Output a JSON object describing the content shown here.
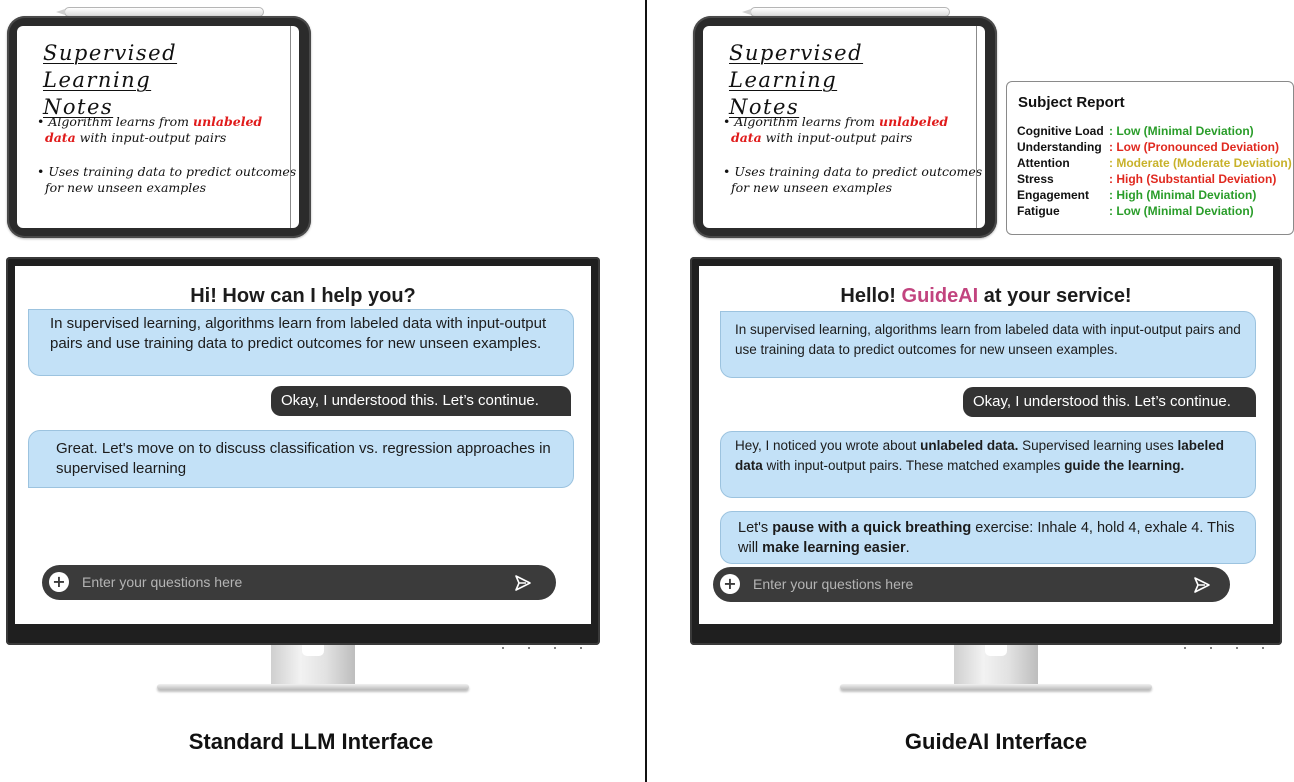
{
  "notes": {
    "title_line1": "Supervised Learning",
    "title_line2": "Notes",
    "bullet1_prefix": "• Algorithm learns from ",
    "bullet1_highlight_a": "unlabeled",
    "bullet1_highlight_b": "data",
    "bullet1_suffix": " with input-output pairs",
    "bullet2_line1": "• Uses training data to predict outcomes",
    "bullet2_line2": "for new unseen examples"
  },
  "report": {
    "title": "Subject Report",
    "rows": [
      {
        "label": "Cognitive Load",
        "value": ": Low (Minimal Deviation)",
        "color": "#2a9d2a"
      },
      {
        "label": "Understanding",
        "value": ": Low (Pronounced Deviation)",
        "color": "#e0291f"
      },
      {
        "label": "Attention",
        "value": ": Moderate (Moderate Deviation)",
        "color": "#c8b22a"
      },
      {
        "label": "Stress",
        "value": ": High (Substantial Deviation)",
        "color": "#e0291f"
      },
      {
        "label": "Engagement",
        "value": ": High (Minimal Deviation)",
        "color": "#2a9d2a"
      },
      {
        "label": "Fatigue",
        "value": ": Low (Minimal Deviation)",
        "color": "#2a9d2a"
      }
    ]
  },
  "standard": {
    "title": "Hi! How can I help you?",
    "msg1": "In supervised learning, algorithms learn from labeled data with input-output pairs and use training data to predict outcomes for new unseen examples.",
    "user_msg": "Okay, I understood this. Let’s continue.",
    "msg2": "Great. Let's move on to discuss classification vs. regression approaches in supervised learning",
    "placeholder": "Enter your questions here",
    "caption": "Standard LLM Interface"
  },
  "guide": {
    "title_prefix": "Hello! ",
    "title_brand": "GuideAI",
    "title_suffix": " at your service!",
    "msg1": "In supervised learning, algorithms learn from labeled data with input-output pairs and use training data to predict outcomes for new unseen examples.",
    "user_msg": "Okay, I understood this. Let’s continue.",
    "msg2_p1": "Hey, I noticed you wrote about ",
    "msg2_b1": "unlabeled data.",
    "msg2_p2": " Supervised learning uses ",
    "msg2_b2": "labeled data",
    "msg2_p3": " with input-output pairs. These matched examples ",
    "msg2_b3": "guide the learning.",
    "msg3_p1": "Let's ",
    "msg3_b1": "pause with a quick breathing",
    "msg3_p2": " exercise: Inhale 4, hold 4, exhale 4. This will ",
    "msg3_b2": "make learning easier",
    "msg3_p3": ".",
    "placeholder": "Enter your questions here",
    "caption": "GuideAI Interface"
  },
  "icons": {
    "add": "plus-icon",
    "send": "send-icon"
  }
}
